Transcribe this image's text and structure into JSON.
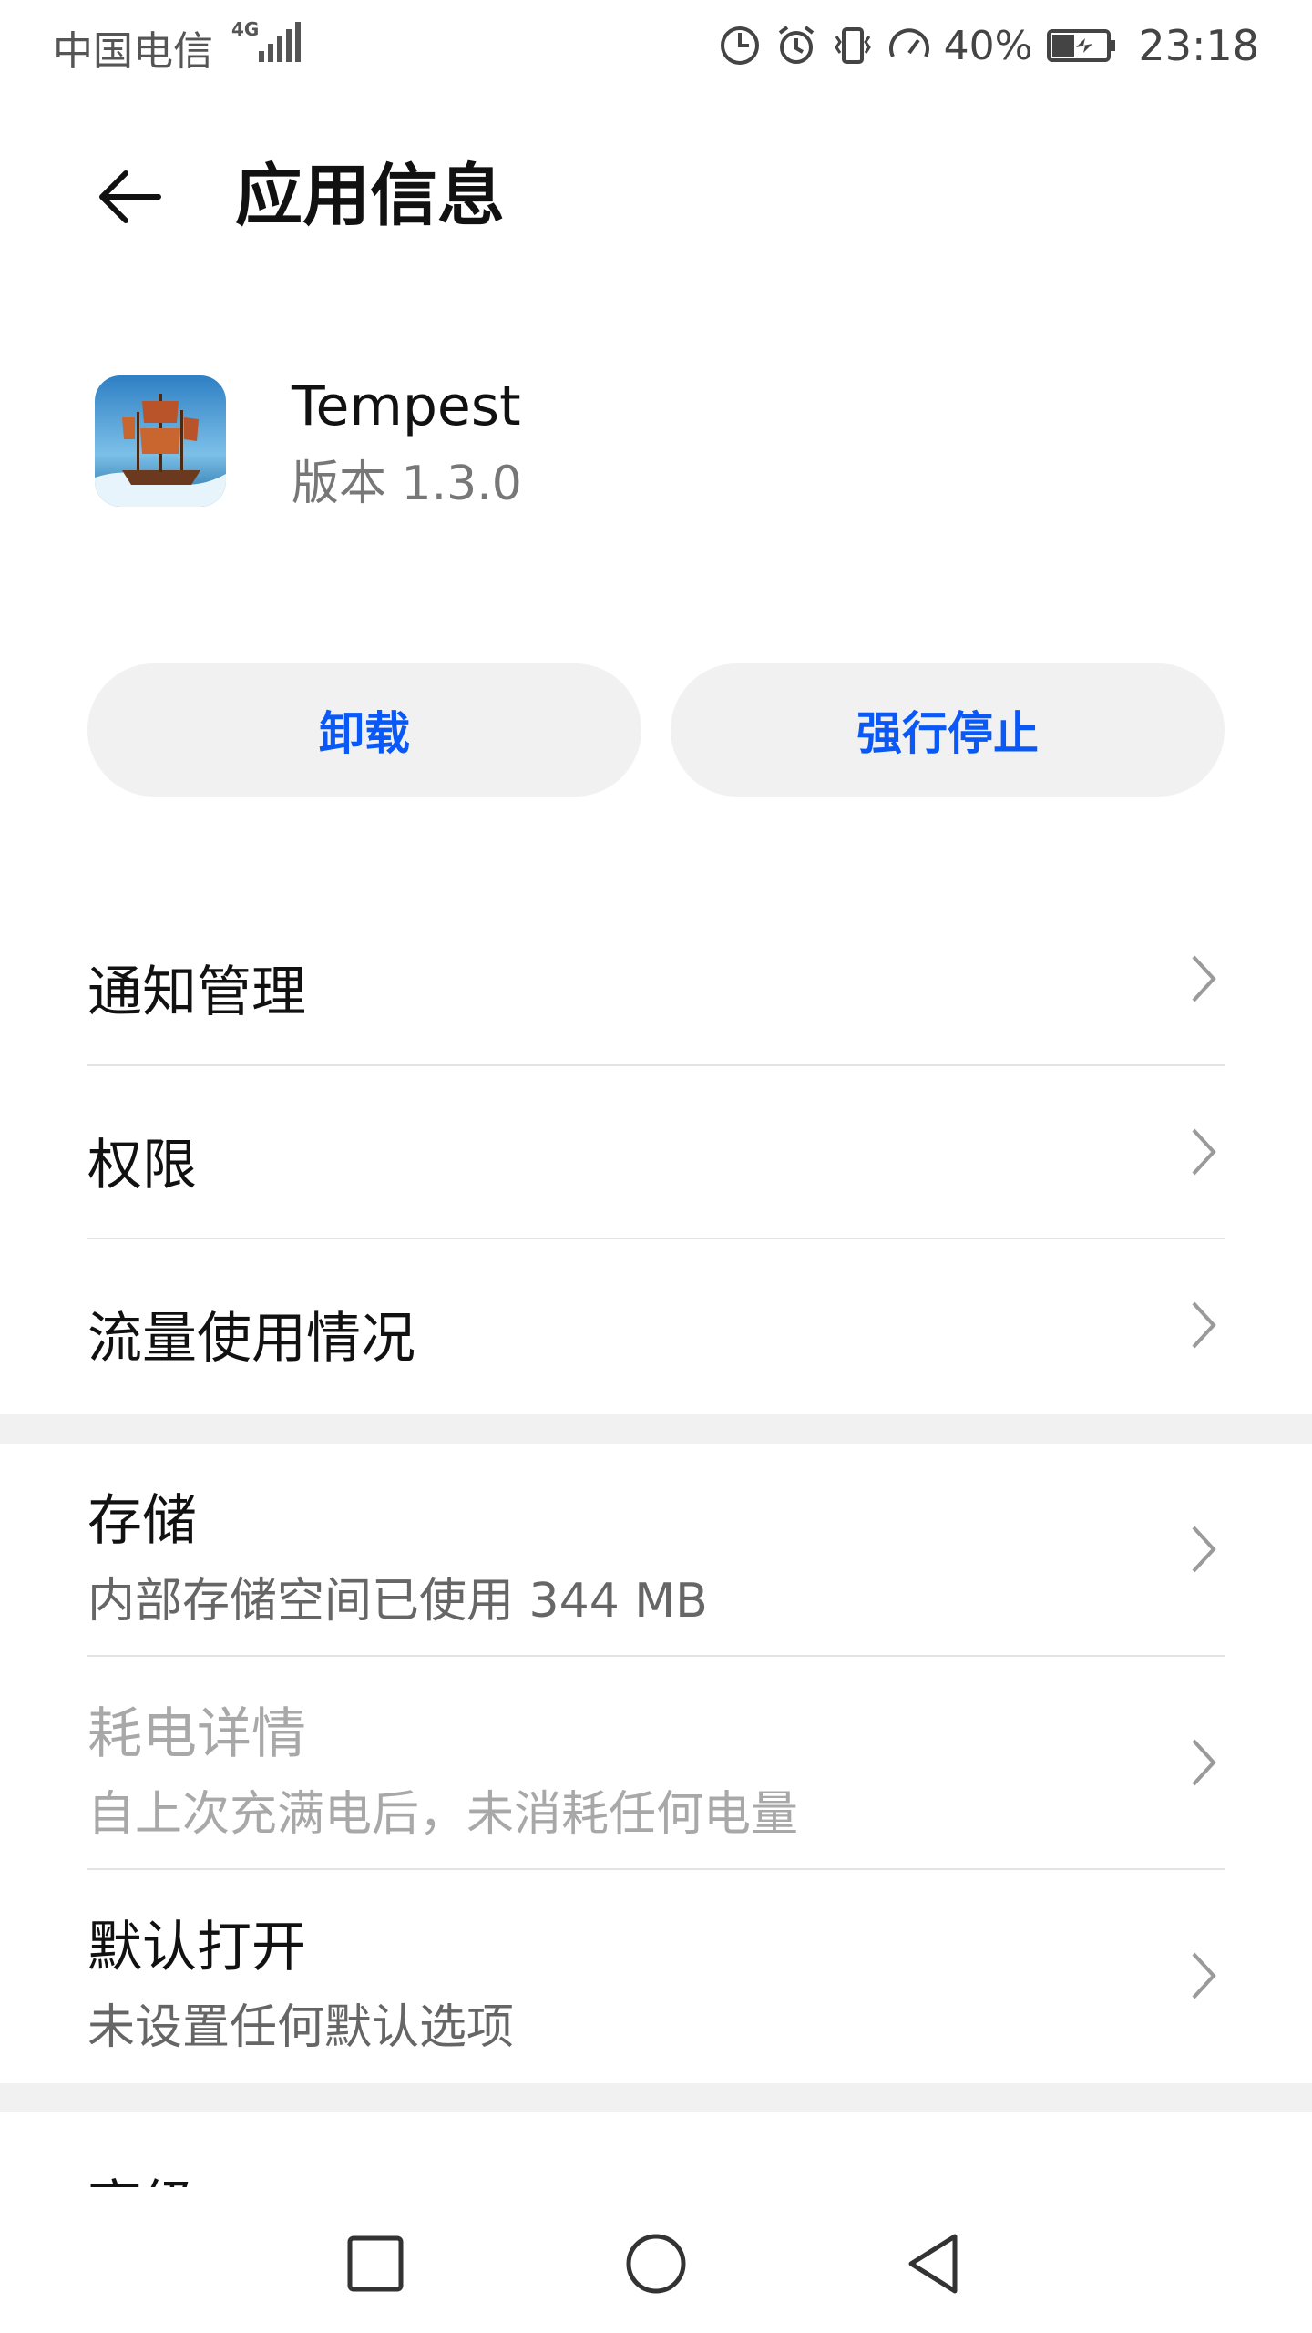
{
  "status_bar": {
    "carrier": "中国电信",
    "network": "4G",
    "battery_percent": "40%",
    "time": "23:18",
    "icons": [
      "signal-icon",
      "data-saver-icon",
      "alarm-icon",
      "vibrate-icon",
      "speed-icon",
      "battery-icon"
    ]
  },
  "header": {
    "title": "应用信息",
    "back_icon": "back-arrow-icon"
  },
  "app": {
    "name": "Tempest",
    "version": "版本 1.3.0",
    "icon": "tempest-ship-icon"
  },
  "actions": {
    "uninstall": "卸载",
    "force_stop": "强行停止"
  },
  "list": {
    "notifications": "通知管理",
    "permissions": "权限",
    "data_usage": "流量使用情况",
    "storage_title": "存储",
    "storage_sub": "内部存储空间已使用 344 MB",
    "battery_title": "耗电详情",
    "battery_sub": "自上次充满电后，未消耗任何电量",
    "default_open_title": "默认打开",
    "default_open_sub": "未设置任何默认选项",
    "advanced": "高级"
  },
  "colors": {
    "accent": "#0a59f7",
    "button_bg": "#f1f1f1",
    "divider": "#e3e3e3",
    "disabled_text": "#a8a8a8"
  }
}
